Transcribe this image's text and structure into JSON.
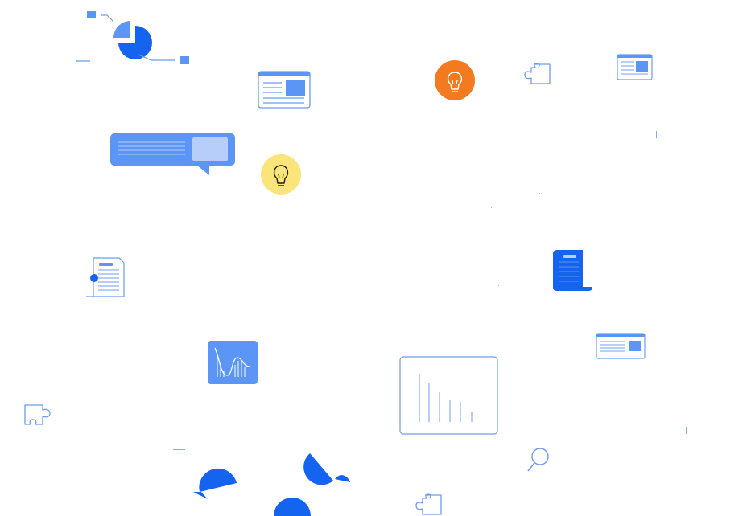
{
  "title": "",
  "colors": {
    "primary_blue": "#1464f0",
    "mid_blue": "#5b95f5",
    "light_blue": "#b7cdfa",
    "outline_blue": "#6d9cf0",
    "orange": "#f47a1f",
    "yellow": "#fbe47a",
    "white": "#ffffff"
  },
  "icons": [
    "pie-chart-icon",
    "browser-window-icon",
    "lightbulb-icon",
    "puzzle-piece-icon",
    "chat-bubble-icon",
    "document-icon",
    "scroll-icon",
    "line-chart-icon",
    "bar-chart-icon",
    "magnifier-icon",
    "semicircle-shape"
  ]
}
